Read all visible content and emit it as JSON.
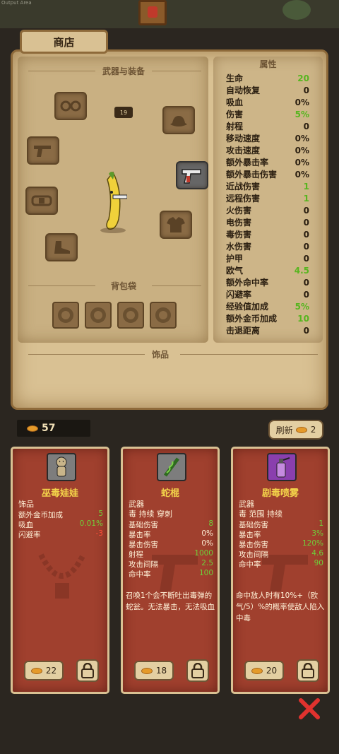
{
  "debug": {
    "output_area_label": "Output Area"
  },
  "shop": {
    "tab_label": "商店"
  },
  "loadout": {
    "weapons_title": "武器与装备",
    "bag_title": "背包袋",
    "accessory_title": "饰品",
    "level_badge": "19"
  },
  "attributes": {
    "title": "属性",
    "rows": [
      {
        "label": "生命",
        "value": "20",
        "positive": true
      },
      {
        "label": "自动恢复",
        "value": "0",
        "positive": false
      },
      {
        "label": "吸血",
        "value": "0%",
        "positive": false
      },
      {
        "label": "伤害",
        "value": "5%",
        "positive": true
      },
      {
        "label": "射程",
        "value": "0",
        "positive": false
      },
      {
        "label": "移动速度",
        "value": "0%",
        "positive": false
      },
      {
        "label": "攻击速度",
        "value": "0%",
        "positive": false
      },
      {
        "label": "额外暴击率",
        "value": "0%",
        "positive": false
      },
      {
        "label": "额外暴击伤害",
        "value": "0%",
        "positive": false
      },
      {
        "label": "近战伤害",
        "value": "1",
        "positive": true
      },
      {
        "label": "远程伤害",
        "value": "1",
        "positive": true
      },
      {
        "label": "火伤害",
        "value": "0",
        "positive": false
      },
      {
        "label": "电伤害",
        "value": "0",
        "positive": false
      },
      {
        "label": "毒伤害",
        "value": "0",
        "positive": false
      },
      {
        "label": "水伤害",
        "value": "0",
        "positive": false
      },
      {
        "label": "护甲",
        "value": "0",
        "positive": false
      },
      {
        "label": "欧气",
        "value": "4.5",
        "positive": true
      },
      {
        "label": "额外命中率",
        "value": "0",
        "positive": false
      },
      {
        "label": "闪避率",
        "value": "0",
        "positive": false
      },
      {
        "label": "经验值加成",
        "value": "5%",
        "positive": true
      },
      {
        "label": "额外金币加成",
        "value": "10",
        "positive": true
      },
      {
        "label": "击退距离",
        "value": "0",
        "positive": false
      }
    ]
  },
  "gold": {
    "amount": "57"
  },
  "refresh": {
    "label": "刷新",
    "cost": "2"
  },
  "cards": [
    {
      "name": "巫毒娃娃",
      "type": "饰品",
      "tags": "",
      "stats": [
        {
          "label": "额外金币加成",
          "value": "5",
          "tone": "pos"
        },
        {
          "label": "吸血",
          "value": "0.01%",
          "tone": "pos"
        },
        {
          "label": "闪避率",
          "value": "-3",
          "tone": "neg"
        }
      ],
      "description": "",
      "price": "22"
    },
    {
      "name": "蛇棍",
      "type": "武器",
      "tags": "毒 持续 穿刺",
      "stats": [
        {
          "label": "基础伤害",
          "value": "8",
          "tone": "pos"
        },
        {
          "label": "暴击率",
          "value": "0%",
          "tone": "plain"
        },
        {
          "label": "暴击伤害",
          "value": "0%",
          "tone": "plain"
        },
        {
          "label": "射程",
          "value": "1000",
          "tone": "pos"
        },
        {
          "label": "攻击间隔",
          "value": "2.5",
          "tone": "pos"
        },
        {
          "label": "命中率",
          "value": "100",
          "tone": "pos"
        }
      ],
      "description": "召唤1个会不断吐出毒弹的蛇瓮。无法暴击，无法吸血",
      "price": "18"
    },
    {
      "name": "剧毒喷雾",
      "type": "武器",
      "tags": "毒 范围 持续",
      "stats": [
        {
          "label": "基础伤害",
          "value": "1",
          "tone": "pos"
        },
        {
          "label": "暴击率",
          "value": "3%",
          "tone": "pos"
        },
        {
          "label": "暴击伤害",
          "value": "120%",
          "tone": "pos"
        },
        {
          "label": "攻击间隔",
          "value": "4.6",
          "tone": "pos"
        },
        {
          "label": "命中率",
          "value": "90",
          "tone": "pos"
        }
      ],
      "description": "命中敌人时有10%+（欧气/5）%的概率使敌人陷入中毒",
      "price": "20"
    }
  ],
  "colors": {
    "positive": "#57b51f",
    "card_positive": "#6fd03a",
    "negative": "#ff4e3a",
    "card_bg": "#a0402e",
    "card_title": "#f3d34a",
    "close": "#e0322e"
  }
}
